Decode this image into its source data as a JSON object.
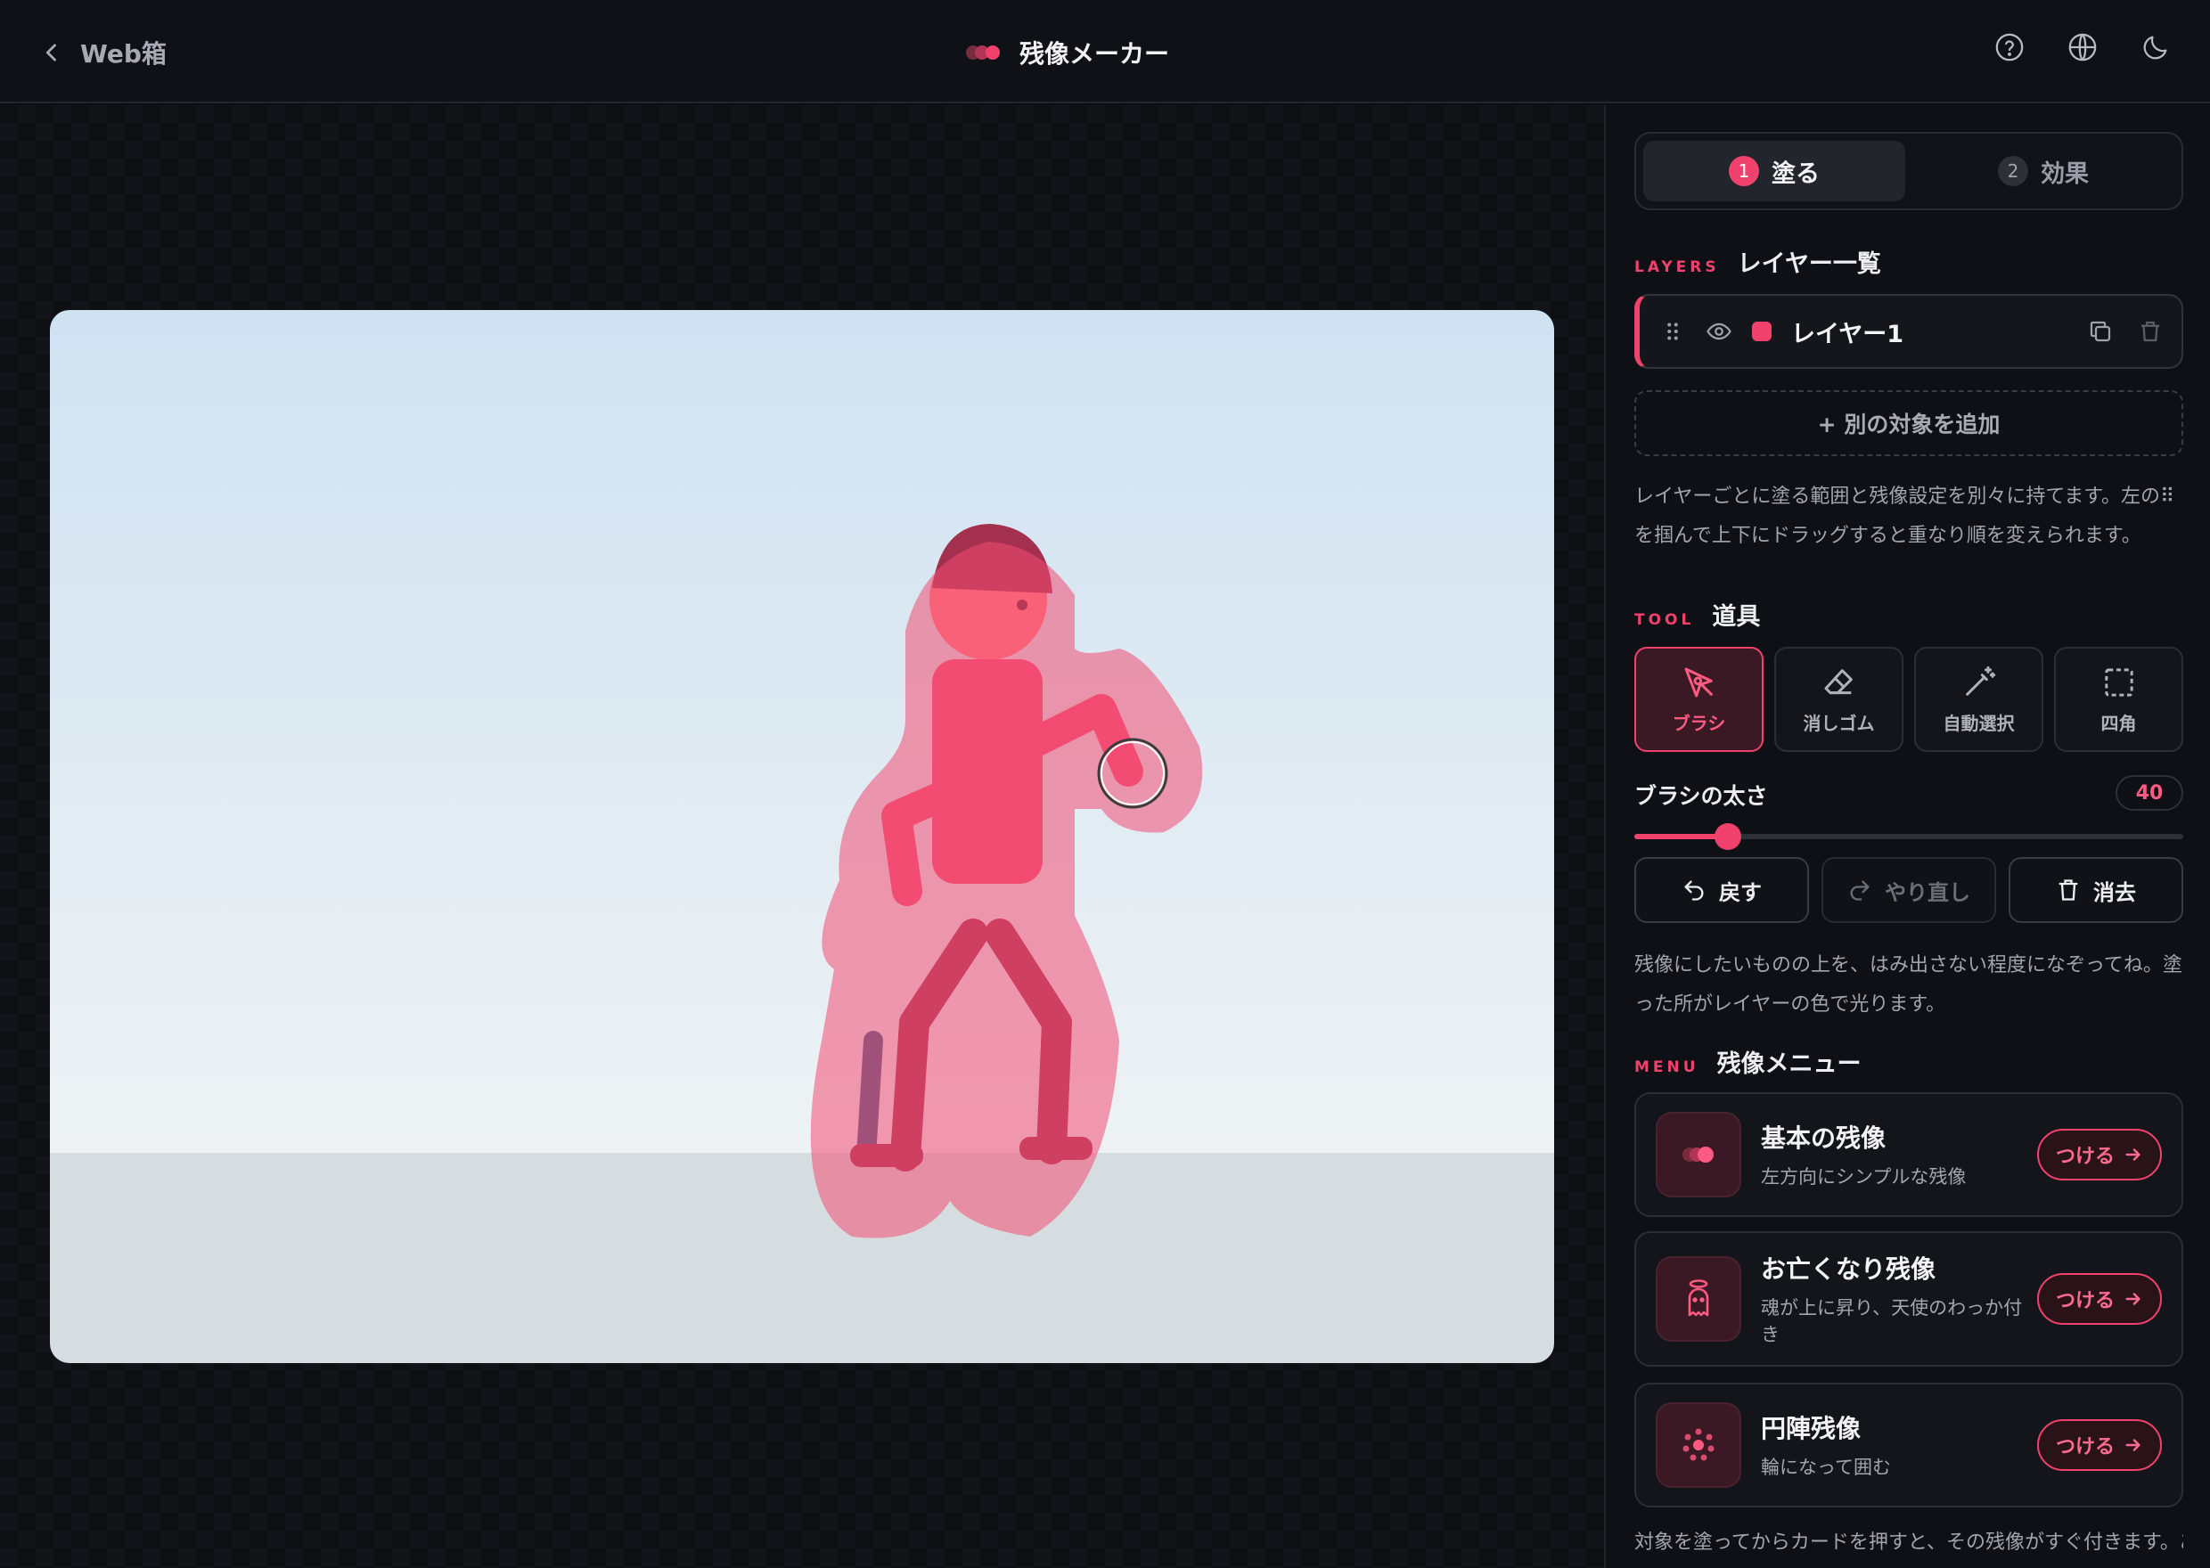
{
  "header": {
    "back_label": "Web箱",
    "title": "残像メーカー",
    "icons": [
      "help-icon",
      "globe-icon",
      "moon-icon"
    ]
  },
  "colors": {
    "accent": "#f0426c",
    "background": "#0d0e12",
    "panel": "#0f1015"
  },
  "steps": [
    {
      "num": "1",
      "label": "塗る",
      "active": true
    },
    {
      "num": "2",
      "label": "効果",
      "active": false
    }
  ],
  "layers_section": {
    "kicker": "LAYERS",
    "title": "レイヤー一覧",
    "layers": [
      {
        "name": "レイヤー1",
        "color": "#f0426c"
      }
    ],
    "add_label": "+ 別の対象を追加",
    "help": "レイヤーごとに塗る範囲と残像設定を別々に持てます。左の⠿を掴んで上下にドラッグすると重なり順を変えられます。"
  },
  "tool_section": {
    "kicker": "TOOL",
    "title": "道具",
    "tools": [
      {
        "label": "ブラシ",
        "icon": "pen-icon",
        "active": true
      },
      {
        "label": "消しゴム",
        "icon": "eraser-icon",
        "active": false
      },
      {
        "label": "自動選択",
        "icon": "magic-wand-icon",
        "active": false
      },
      {
        "label": "四角",
        "icon": "rect-select-icon",
        "active": false
      }
    ],
    "brush_size_label": "ブラシの太さ",
    "brush_size": 40,
    "brush_size_fraction": 0.17,
    "actions": {
      "undo": "戻す",
      "redo": "やり直し",
      "clear": "消去"
    },
    "help": "残像にしたいものの上を、はみ出さない程度になぞってね。塗った所がレイヤーの色で光ります。"
  },
  "menu_section": {
    "kicker": "MENU",
    "title": "残像メニュー",
    "items": [
      {
        "title": "基本の残像",
        "desc": "左方向にシンプルな残像",
        "icon": "afterimage-dots-icon",
        "button": "つける"
      },
      {
        "title": "お亡くなり残像",
        "desc": "魂が上に昇り、天使のわっか付き",
        "icon": "ghost-halo-icon",
        "button": "つける"
      },
      {
        "title": "円陣残像",
        "desc": "輪になって囲む",
        "icon": "circle-formation-icon",
        "button": "つける"
      }
    ],
    "footer": "対象を塗ってからカードを押すと、その残像がすぐ付きます。あと"
  }
}
